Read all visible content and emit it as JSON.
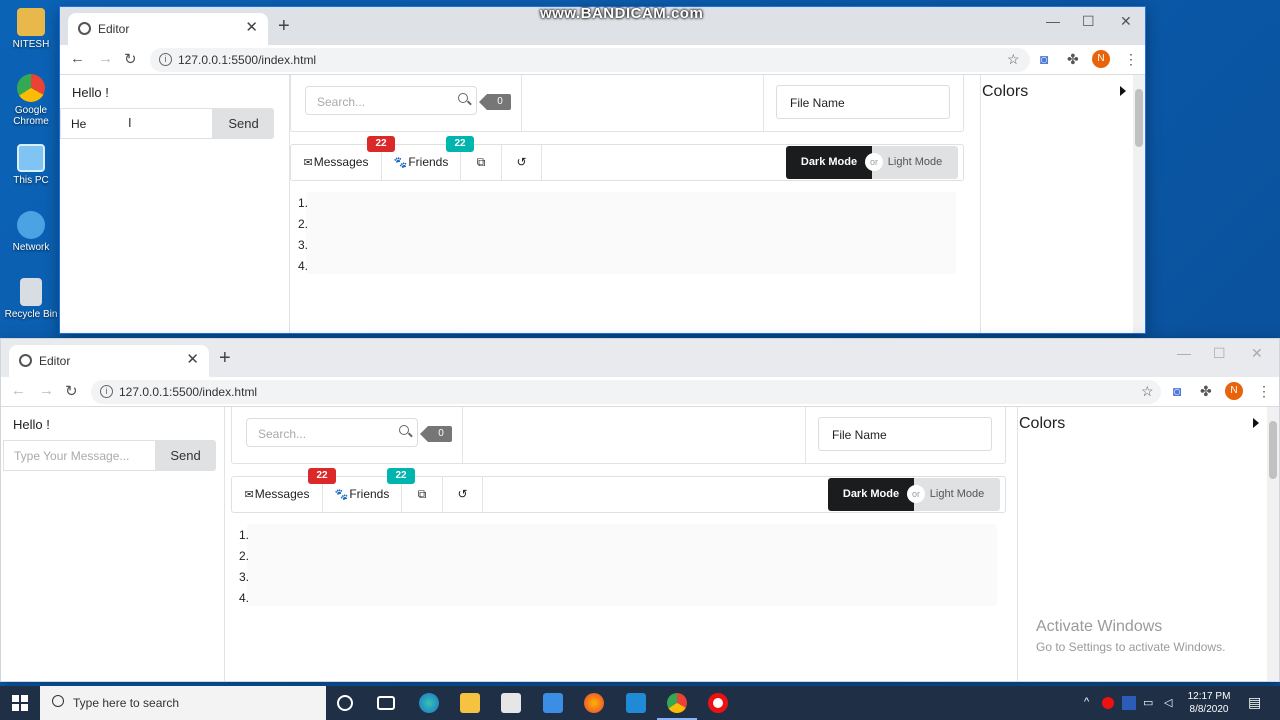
{
  "watermark": "www.BANDICAM.com",
  "desktop": {
    "icons": [
      {
        "label": "NITESH"
      },
      {
        "label": "Google Chrome"
      },
      {
        "label": "This PC"
      },
      {
        "label": "Network"
      },
      {
        "label": "Recycle Bin"
      }
    ]
  },
  "browser": {
    "tab_title": "Editor",
    "url": "127.0.0.1:5500/index.html",
    "avatar_initial": "N"
  },
  "app": {
    "greeting": "Hello !",
    "message_value_top": "He",
    "message_placeholder": "Type Your Message...",
    "send_label": "Send",
    "search_placeholder": "Search...",
    "search_count": "0",
    "file_name_label": "File Name",
    "menu": {
      "messages_label": "Messages",
      "messages_count": "22",
      "friends_label": "Friends",
      "friends_count": "22",
      "dark_mode_label": "Dark Mode",
      "or_label": "or",
      "light_mode_label": "Light Mode"
    },
    "line_numbers": [
      "1.",
      "2.",
      "3.",
      "4."
    ],
    "colors_title": "Colors"
  },
  "activation": {
    "title": "Activate Windows",
    "subtitle": "Go to Settings to activate Windows."
  },
  "taskbar": {
    "search_placeholder": "Type here to search",
    "time": "12:17 PM",
    "date": "8/8/2020"
  },
  "colors": {
    "accent_red": "#db2828",
    "accent_teal": "#00b5ad",
    "dark_button": "#1b1c1d",
    "desktop_blue": "#0a5fb0"
  }
}
